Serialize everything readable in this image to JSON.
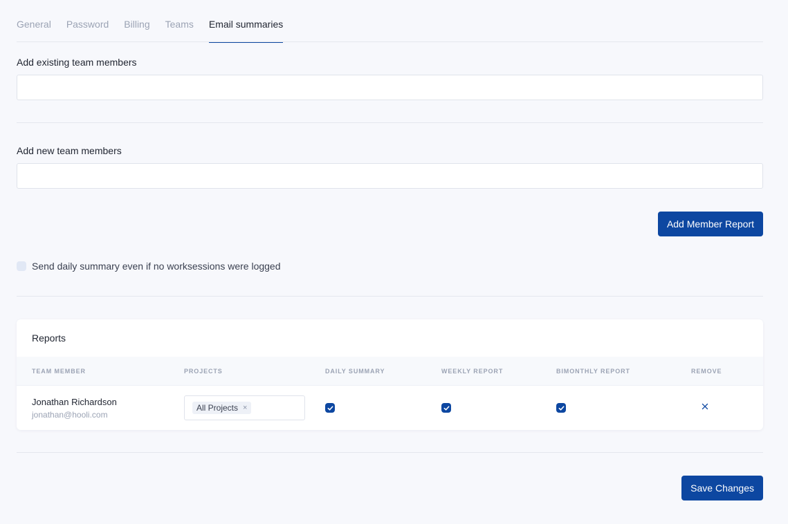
{
  "tabs": [
    {
      "label": "General",
      "active": false
    },
    {
      "label": "Password",
      "active": false
    },
    {
      "label": "Billing",
      "active": false
    },
    {
      "label": "Teams",
      "active": false
    },
    {
      "label": "Email summaries",
      "active": true
    }
  ],
  "form": {
    "existing_label": "Add existing team members",
    "existing_value": "",
    "new_label": "Add new team members",
    "new_value": "",
    "add_button": "Add Member Report",
    "daily_toggle_label": "Send daily summary even if no worksessions were logged"
  },
  "reports": {
    "title": "Reports",
    "columns": [
      "TEAM MEMBER",
      "PROJECTS",
      "DAILY SUMMARY",
      "WEEKLY REPORT",
      "BIMONTHLY REPORT",
      "REMOVE"
    ],
    "rows": [
      {
        "name": "Jonathan Richardson",
        "email": "jonathan@hooli.com",
        "projects": "All Projects",
        "daily": true,
        "weekly": true,
        "bimonthly": true
      }
    ]
  },
  "footer": {
    "save_button": "Save Changes"
  },
  "colors": {
    "accent": "#0d47a1",
    "background": "#f7f8fc",
    "muted_text": "#9ba3b4"
  },
  "icons": {
    "check": "checkmark-icon",
    "remove": "close-icon",
    "chip_remove": "close-icon"
  }
}
